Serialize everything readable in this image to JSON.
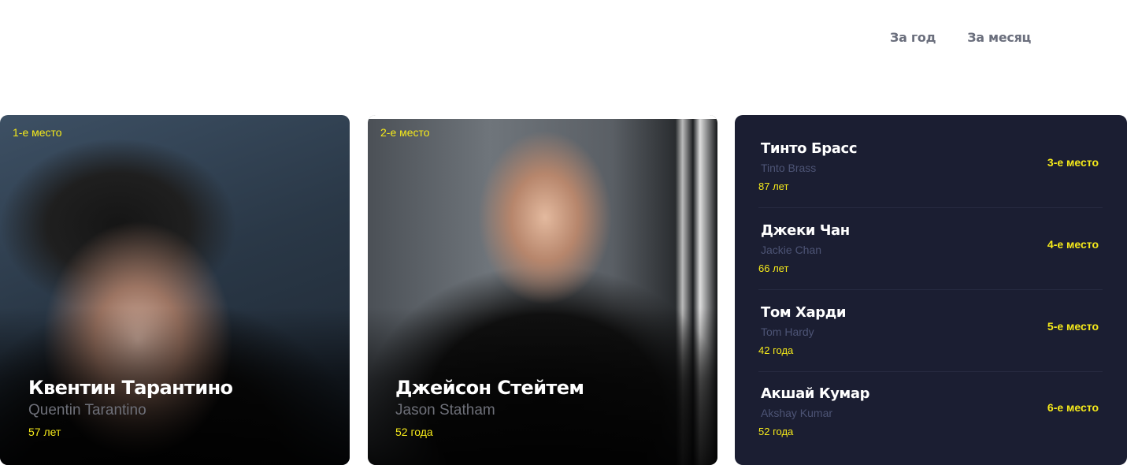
{
  "tabs": [
    {
      "label": "За год"
    },
    {
      "label": "За месяц"
    }
  ],
  "featured": [
    {
      "rank": "1-е место",
      "name_ru": "Квентин Тарантино",
      "name_en": "Quentin Tarantino",
      "age": "57 лет"
    },
    {
      "rank": "2-е место",
      "name_ru": "Джейсон Стейтем",
      "name_en": "Jason Statham",
      "age": "52 года"
    }
  ],
  "list": [
    {
      "name_ru": "Тинто Брасс",
      "name_en": "Tinto Brass",
      "age": "87 лет",
      "rank": "3-е место"
    },
    {
      "name_ru": "Джеки Чан",
      "name_en": "Jackie Chan",
      "age": "66 лет",
      "rank": "4-е место"
    },
    {
      "name_ru": "Том Харди",
      "name_en": "Tom Hardy",
      "age": "42 года",
      "rank": "5-е место"
    },
    {
      "name_ru": "Акшай Кумар",
      "name_en": "Akshay Kumar",
      "age": "52 года",
      "rank": "6-е место"
    }
  ],
  "colors": {
    "accent": "#f6ea1a",
    "panel": "#1b1e32",
    "tab_text": "#6b6f7d",
    "subtitle": "#6e7079"
  }
}
